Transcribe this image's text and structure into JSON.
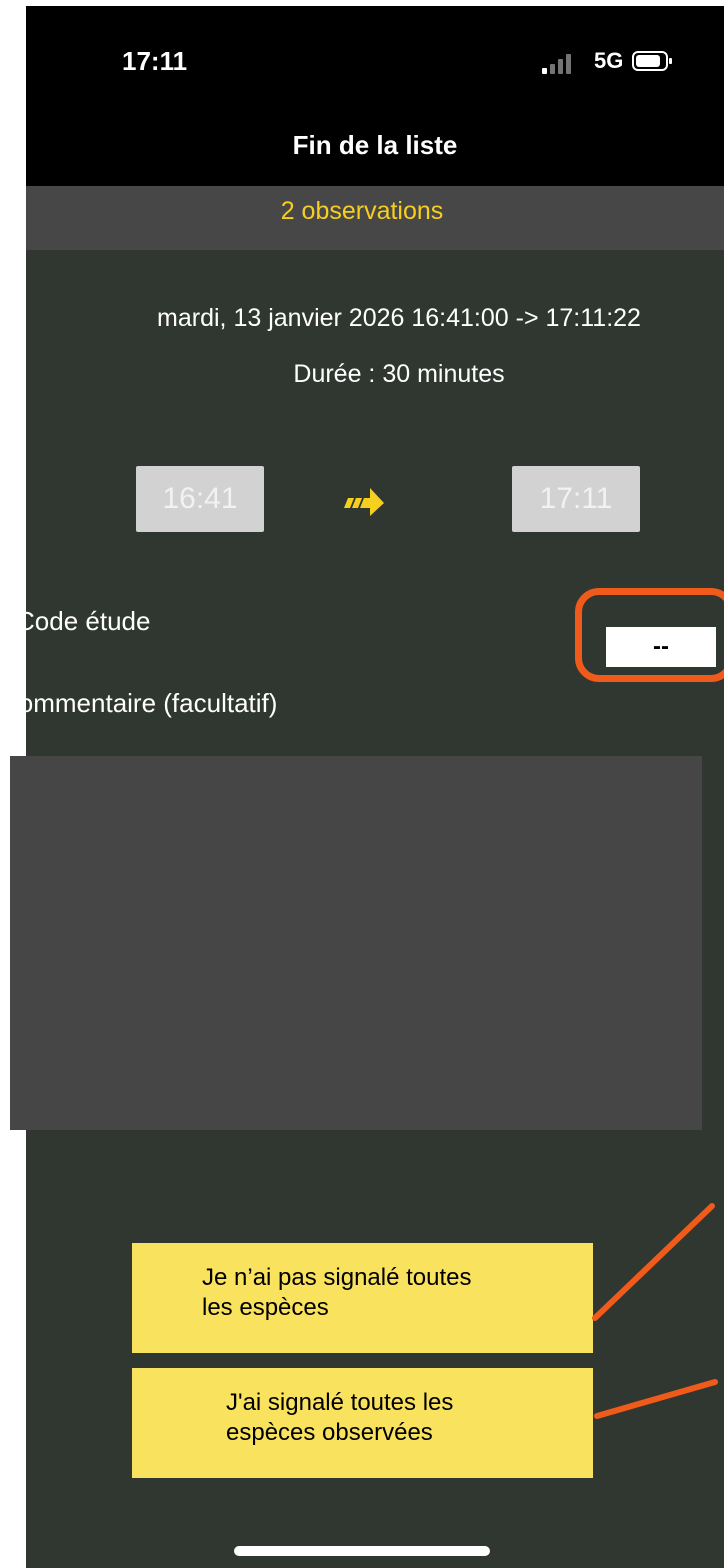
{
  "status_bar": {
    "time": "17:11",
    "network": "5G"
  },
  "header": {
    "title": "Fin de la liste"
  },
  "observations_bar": {
    "label": "2 observations"
  },
  "session": {
    "date_range": "mardi, 13 janvier 2026 16:41:00 -> 17:11:22",
    "duration": "Durée : 30 minutes",
    "start_time": "16:41",
    "end_time": "17:11"
  },
  "study_code": {
    "label": "Code étude",
    "value": "--"
  },
  "comment": {
    "label": "Commentaire (facultatif)",
    "value": ""
  },
  "buttons": {
    "not_all_species_line1": "Je n’ai pas signalé toutes",
    "not_all_species_line2": "les espèces",
    "all_species_line1": "J'ai signalé toutes les",
    "all_species_line2": "espèces observées"
  },
  "colors": {
    "background": "#2f3730",
    "accent_yellow": "#f6cf1f",
    "button_yellow": "#f8e25e",
    "annotation_orange": "#f05a1a"
  },
  "icons": {
    "arrow": "double-arrow-right-icon",
    "signal": "cellular-signal-icon",
    "battery": "battery-icon"
  }
}
